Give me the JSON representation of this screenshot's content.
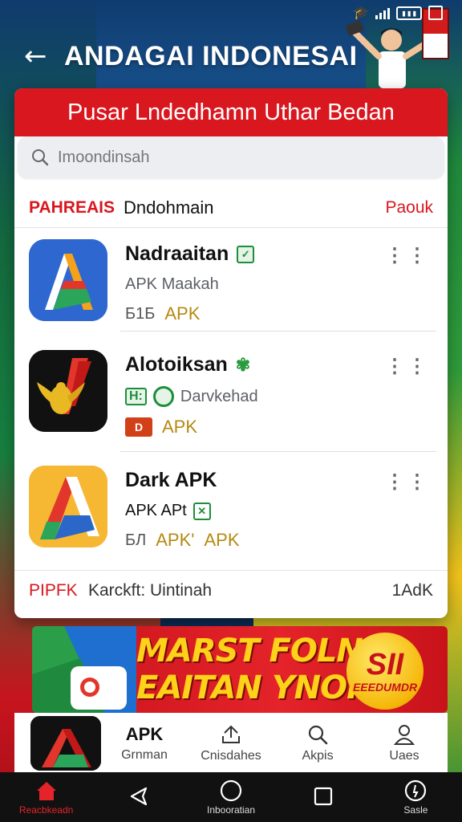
{
  "header": {
    "title": "ANDAGAI INDONESAI"
  },
  "card": {
    "heading": "Pusar Lndedhamn Uthar Bedan",
    "search": {
      "placeholder": "Imoondinsah"
    },
    "section": {
      "left": "PAHREAIS",
      "middle": "Dndohmain",
      "right": "Paouk"
    },
    "apps": [
      {
        "name": "Nadraaitan",
        "sub": "APK Maakah",
        "meta_prefix": "Б1Б",
        "apk": "APK"
      },
      {
        "name": "Alotoiksan",
        "sub_badge": "H:",
        "sub": "Darvkehad",
        "apk": "APK"
      },
      {
        "name": "Dark APK",
        "sub": "APK APt",
        "meta_prefix": "БЛ",
        "apk": "APK'",
        "apk2": "APK"
      }
    ],
    "info_row": {
      "left": "PIPFK",
      "middle": "Karckft: Uintinah",
      "right": "1AdK"
    }
  },
  "banner": {
    "line1": "MARST FOLN",
    "line2": "EAITAN YNOKS",
    "coin_big": "SII",
    "coin_small": "EEEDUMDR"
  },
  "app_nav": {
    "items": [
      {
        "top": "APK",
        "label": "Grnman"
      },
      {
        "label": "Cnisdahes"
      },
      {
        "label": "Akpis"
      },
      {
        "label": "Uaes"
      }
    ]
  },
  "system_nav": {
    "items": [
      {
        "label": "Reacbkeadn"
      },
      {
        "label": ""
      },
      {
        "label": "Inbooratian"
      },
      {
        "label": ""
      },
      {
        "label": "Sasle"
      }
    ]
  },
  "colors": {
    "brand_red": "#d9171f",
    "apk_gold": "#b48a10",
    "banner_yellow": "#ffd21a"
  }
}
